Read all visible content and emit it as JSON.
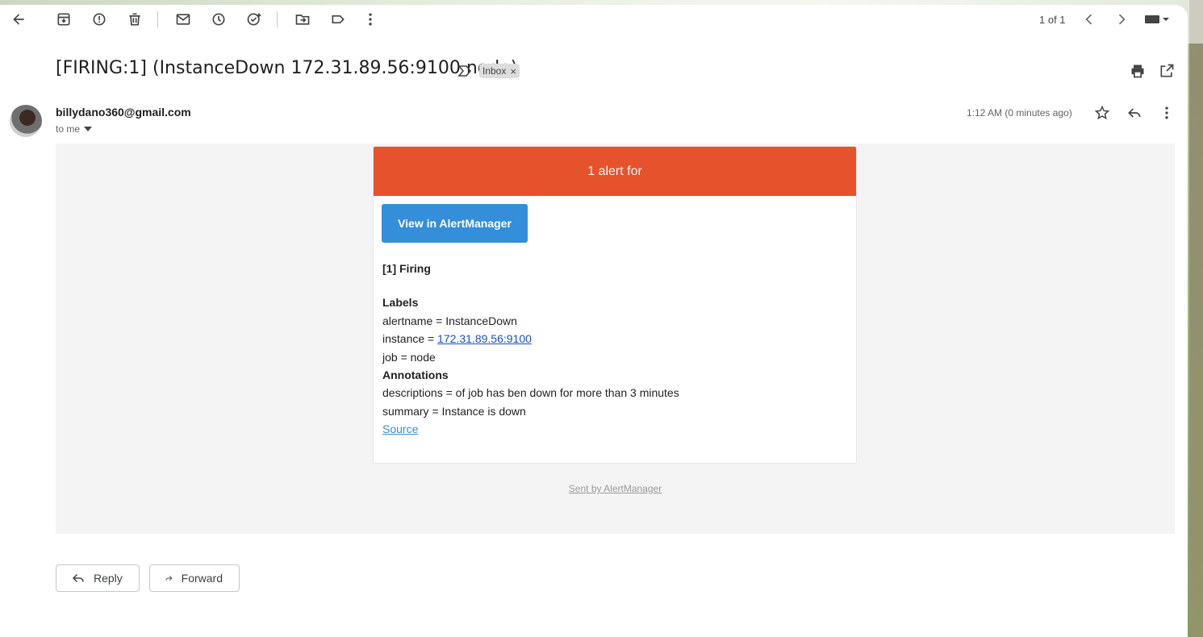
{
  "toolbar": {
    "pager": "1 of 1"
  },
  "email": {
    "subject": "[FIRING:1] (InstanceDown 172.31.89.56:9100 node)",
    "label_chip": "Inbox",
    "label_chip_close": "×",
    "sender": "billydano360@gmail.com",
    "recipient": "to me",
    "timestamp": "1:12 AM (0 minutes ago)"
  },
  "alert": {
    "header": "1 alert for",
    "view_button": "View in AlertManager",
    "firing": "[1] Firing",
    "labels_heading": "Labels",
    "alertname": "alertname = InstanceDown",
    "instance_prefix": "instance = ",
    "instance_link": "172.31.89.56:9100",
    "job": "job = node",
    "annotations_heading": "Annotations",
    "descriptions": "descriptions = of job has ben down for more than 3 minutes",
    "summary": "summary = Instance is down",
    "source_link": "Source",
    "sent_by": "Sent by AlertManager"
  },
  "actions": {
    "reply": "Reply",
    "forward": "Forward"
  },
  "colors": {
    "alert_header": "#e6522c",
    "button": "#348eda"
  }
}
